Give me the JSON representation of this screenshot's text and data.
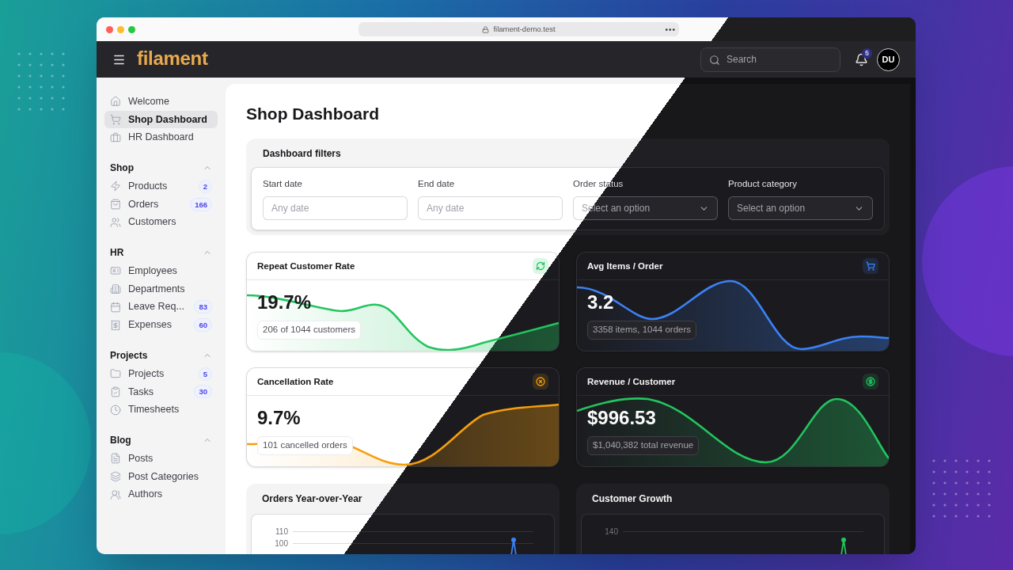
{
  "browser": {
    "url": "filament-demo.test",
    "menu": "•••"
  },
  "header": {
    "logo": "filament",
    "search_placeholder": "Search",
    "notification_count": "5",
    "avatar": "DU"
  },
  "sidebar": {
    "items": [
      {
        "label": "Welcome",
        "selected": false
      },
      {
        "label": "Shop Dashboard",
        "selected": true
      },
      {
        "label": "HR Dashboard",
        "selected": false
      }
    ],
    "groups": [
      {
        "label": "Shop",
        "expanded": true,
        "items": [
          {
            "label": "Products",
            "badge": "2",
            "selected": false
          },
          {
            "label": "Orders",
            "badge": "166",
            "selected": false
          },
          {
            "label": "Customers",
            "selected": false
          }
        ]
      },
      {
        "label": "HR",
        "expanded": true,
        "items": [
          {
            "label": "Employees",
            "selected": false
          },
          {
            "label": "Departments",
            "selected": false
          },
          {
            "label": "Leave Req...",
            "badge": "83",
            "selected": false
          },
          {
            "label": "Expenses",
            "badge": "60",
            "selected": false
          }
        ]
      },
      {
        "label": "Projects",
        "expanded": true,
        "items": [
          {
            "label": "Projects",
            "badge": "5",
            "selected": false
          },
          {
            "label": "Tasks",
            "badge": "30",
            "selected": false
          },
          {
            "label": "Timesheets",
            "selected": false
          }
        ]
      },
      {
        "label": "Blog",
        "expanded": true,
        "items": [
          {
            "label": "Posts",
            "selected": false
          },
          {
            "label": "Post Categories",
            "selected": false
          },
          {
            "label": "Authors",
            "selected": false
          }
        ]
      }
    ]
  },
  "page_title": "Shop Dashboard",
  "filters": {
    "title": "Dashboard filters",
    "fields": [
      {
        "kind": "date",
        "label": "Start date",
        "placeholder": "Any date"
      },
      {
        "kind": "date",
        "label": "End date",
        "placeholder": "Any date"
      },
      {
        "kind": "select",
        "label": "Order status",
        "placeholder": "Select an option"
      },
      {
        "kind": "select",
        "label": "Product category",
        "placeholder": "Select an option"
      }
    ]
  },
  "stats": [
    {
      "title": "Repeat Customer Rate",
      "value": "19.7%",
      "description": "206 of 1044 customers",
      "color": "#22c55e"
    },
    {
      "title": "Avg Items / Order",
      "value": "3.2",
      "description": "3358 items, 1044 orders",
      "color": "#3b82f6"
    },
    {
      "title": "Cancellation Rate",
      "value": "9.7%",
      "description": "101 cancelled orders",
      "color": "#f59e0b"
    },
    {
      "title": "Revenue / Customer",
      "value": "$996.53",
      "description": "$1,040,382 total revenue",
      "color": "#22c55e"
    }
  ],
  "charts": [
    {
      "title": "Orders Year-over-Year",
      "ticks": [
        "110",
        "100"
      ],
      "color": "#3b82f6"
    },
    {
      "title": "Customer Growth",
      "ticks": [
        "140"
      ],
      "color": "#22c55e"
    }
  ]
}
